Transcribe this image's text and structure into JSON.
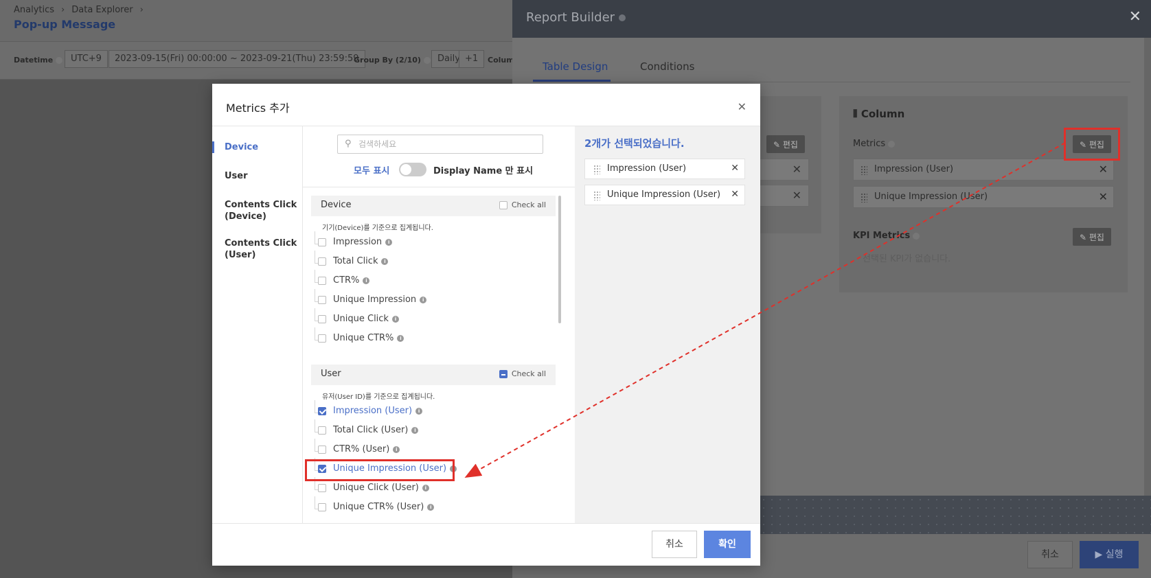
{
  "base": {
    "breadcrumb": [
      "Analytics",
      "Data Explorer"
    ],
    "page_title": "Pop-up Message",
    "filters": {
      "datetime_label": "Datetime",
      "timezone": "UTC+9",
      "range": "2023-09-15(Fri) 00:00:00 ~ 2023-09-21(Thu) 23:59:59",
      "group_by_label": "Group By (2/10)",
      "group_by_value": "Daily",
      "group_by_extra": "+1",
      "column_label": "Colum"
    }
  },
  "report_builder": {
    "title": "Report Builder",
    "close_icon": "✕",
    "tabs": [
      "Table Design",
      "Conditions"
    ],
    "active_tab": 0,
    "left_edit_label": "✎ 편집",
    "column": {
      "title": "Column",
      "metrics_label": "Metrics",
      "edit_label": "✎ 편집",
      "metrics": [
        "Impression (User)",
        "Unique Impression (User)"
      ],
      "kpi_label": "KPI Metrics",
      "kpi_edit_label": "✎ 편집",
      "kpi_empty": "선택된 KPI가 없습니다."
    },
    "footer": {
      "cancel": "취소",
      "run": "▶ 실행"
    }
  },
  "modal": {
    "title": "Metrics 추가",
    "close_icon": "✕",
    "nav": [
      {
        "label": "Device",
        "active": true
      },
      {
        "label": "User",
        "active": false
      },
      {
        "label": "Contents Click (Device)",
        "active": false
      },
      {
        "label": "Contents Click (User)",
        "active": false
      }
    ],
    "search_placeholder": "검색하세요",
    "toggle_left": "모두 표시",
    "toggle_right": "Display Name 만 표시",
    "groups": [
      {
        "name": "Device",
        "check_all": "Check all",
        "description": "기기(Device)를 기준으로 집계됩니다.",
        "metrics": [
          {
            "label": "Impression",
            "checked": false
          },
          {
            "label": "Total Click",
            "checked": false
          },
          {
            "label": "CTR%",
            "checked": false
          },
          {
            "label": "Unique Impression",
            "checked": false
          },
          {
            "label": "Unique Click",
            "checked": false
          },
          {
            "label": "Unique CTR%",
            "checked": false
          }
        ]
      },
      {
        "name": "User",
        "check_all": "Check all",
        "description": "유저(User ID)를 기준으로 집계됩니다.",
        "metrics": [
          {
            "label": "Impression (User)",
            "checked": true
          },
          {
            "label": "Total Click (User)",
            "checked": false
          },
          {
            "label": "CTR% (User)",
            "checked": false
          },
          {
            "label": "Unique Impression (User)",
            "checked": true
          },
          {
            "label": "Unique Click (User)",
            "checked": false
          },
          {
            "label": "Unique CTR% (User)",
            "checked": false
          }
        ]
      }
    ],
    "selected_count": "2개가 선택되었습니다.",
    "selected": [
      "Impression (User)",
      "Unique Impression (User)"
    ],
    "footer": {
      "cancel": "취소",
      "ok": "확인"
    }
  },
  "colors": {
    "accent": "#4a6fc7",
    "primary_button": "#5c85e0",
    "annotation": "#e0302a"
  }
}
